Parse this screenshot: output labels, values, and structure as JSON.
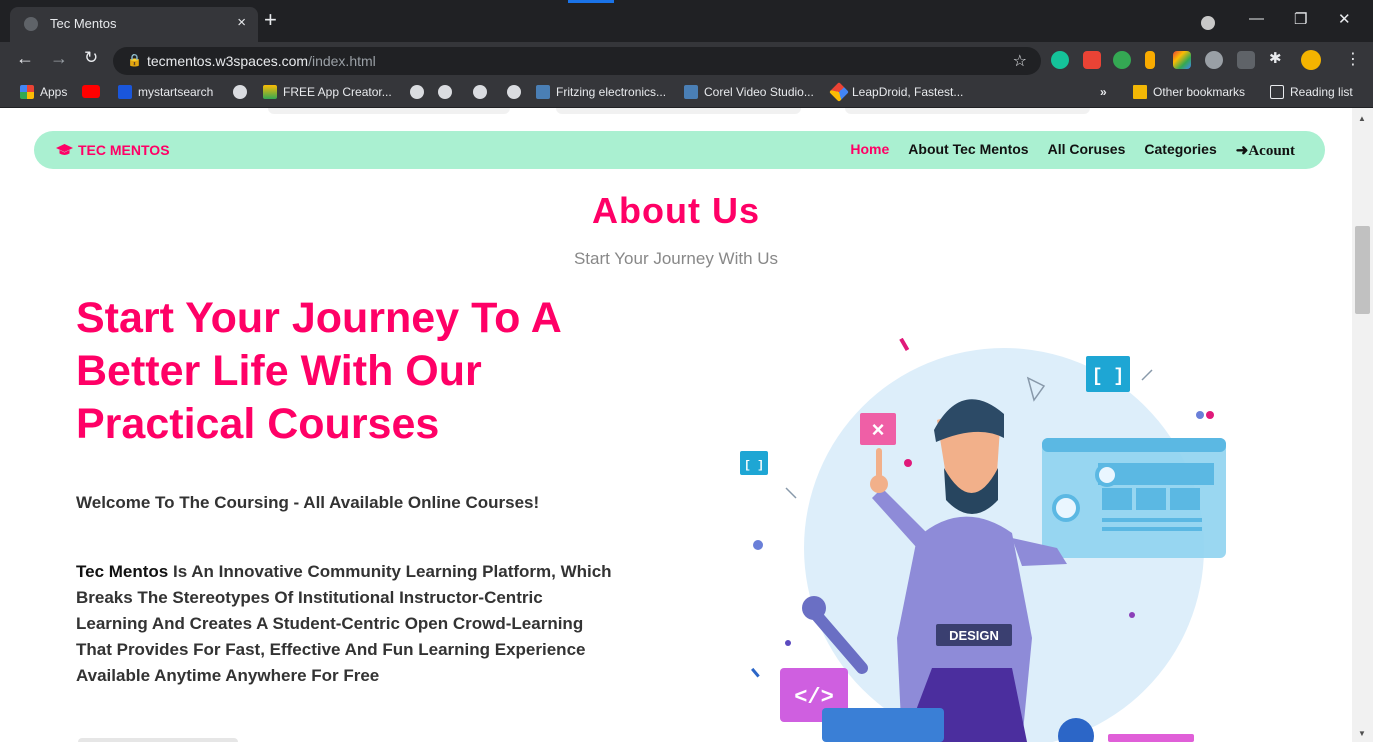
{
  "browser": {
    "tab_title": "Tec Mentos",
    "tab_close": "×",
    "new_tab": "+",
    "url_host": "tecmentos.w3spaces.com",
    "url_path": "/index.html",
    "bookmarks": [
      {
        "label": "Apps"
      },
      {
        "label": "mystartsearch"
      },
      {
        "label": "FREE App Creator..."
      },
      {
        "label": "Fritzing electronics..."
      },
      {
        "label": "Corel Video Studio..."
      },
      {
        "label": "LeapDroid, Fastest..."
      }
    ],
    "overflow": "»",
    "other_bookmarks": "Other bookmarks",
    "reading_list": "Reading list"
  },
  "nav": {
    "brand": "TEC MENTOS",
    "links": [
      "Home",
      "About Tec Mentos",
      "All Coruses",
      "Categories"
    ],
    "account": "Acount",
    "account_icon": "sign-in-icon",
    "brand_icon": "graduation-cap-icon"
  },
  "about": {
    "title": "About Us",
    "subtitle": "Start Your Journey With Us",
    "heading": "Start Your Journey To A Better Life With Our Practical Courses",
    "welcome": "Welcome To The Coursing - All Available Online Courses!",
    "brand_name": "Tec Mentos",
    "description": " Is An Innovative Community Learning Platform, Which Breaks The Stereotypes Of Institutional Instructor-Centric Learning And Creates A Student-Centric Open Crowd-Learning That Provides For Fast, Effective And Fun Learning Experience Available Anytime Anywhere For Free"
  },
  "illustration": {
    "shirt_text": "DESIGN",
    "code_symbol": "</>",
    "bracket_symbol": "[ ]",
    "small_bracket_symbol": "[ ]",
    "close_symbol": "×"
  },
  "colors": {
    "accent": "#ff0066",
    "navbar_bg": "#aaf0d1",
    "text": "#333333"
  }
}
